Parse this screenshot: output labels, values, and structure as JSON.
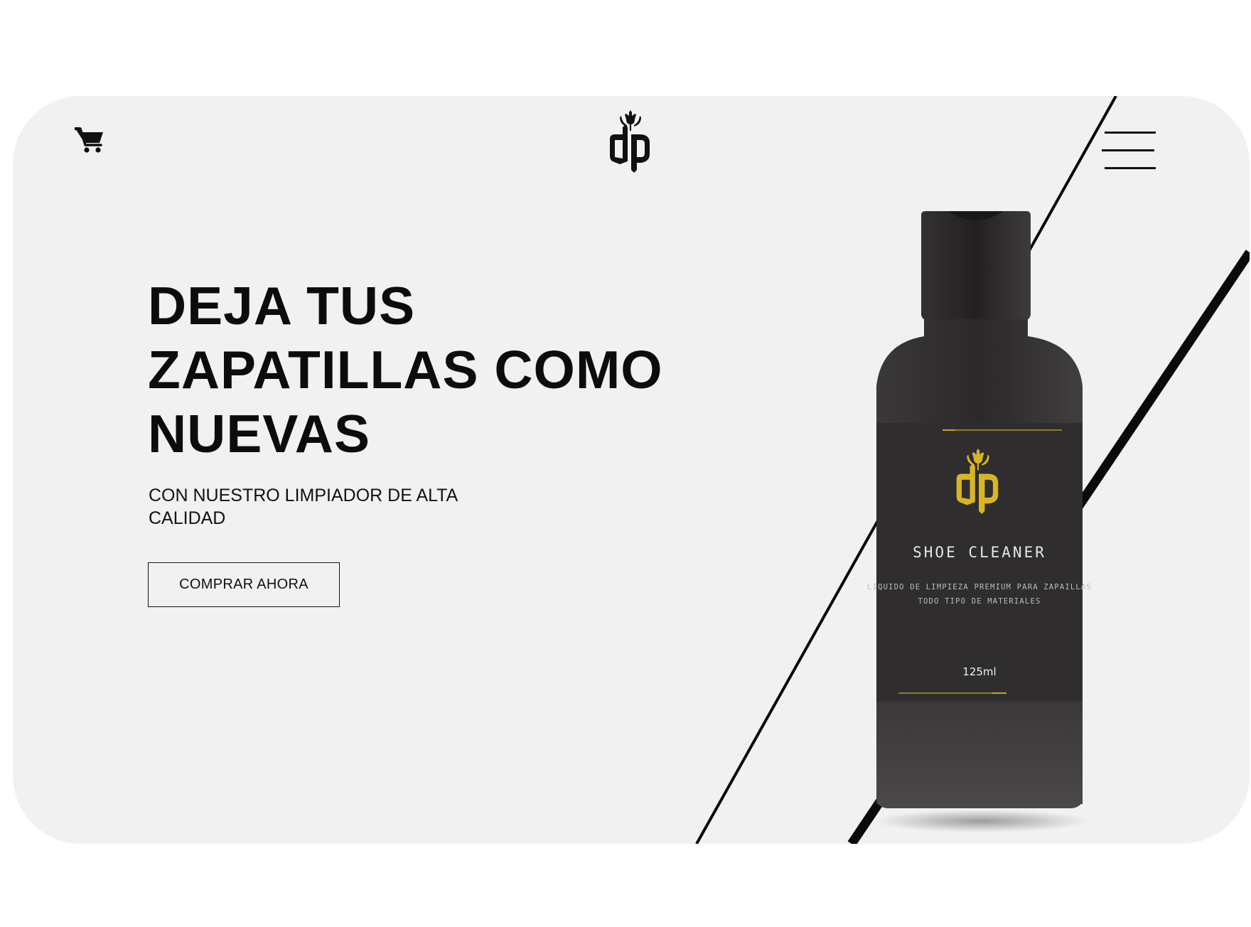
{
  "header": {
    "cart_icon": "shopping-cart-icon",
    "logo_icon": "dp-trident-logo",
    "menu_icon": "hamburger-menu-icon"
  },
  "hero": {
    "headline": "DEJA TUS\nZAPATILLAS COMO\nNUEVAS",
    "subheadline": "CON NUESTRO LIMPIADOR DE ALTA CALIDAD",
    "cta_label": "COMPRAR AHORA"
  },
  "product": {
    "name": "SHOE CLEANER",
    "description_line1": "LIQUIDO DE LIMPIEZA PREMIUM PARA ZAPAILLAS",
    "description_line2": "TODO TIPO DE MATERIALES",
    "volume": "125ml"
  },
  "colors": {
    "background": "#f1f1f1",
    "text": "#0c0c0c",
    "bottle": "#2d2b2c",
    "accent_gold": "#d8b527"
  }
}
